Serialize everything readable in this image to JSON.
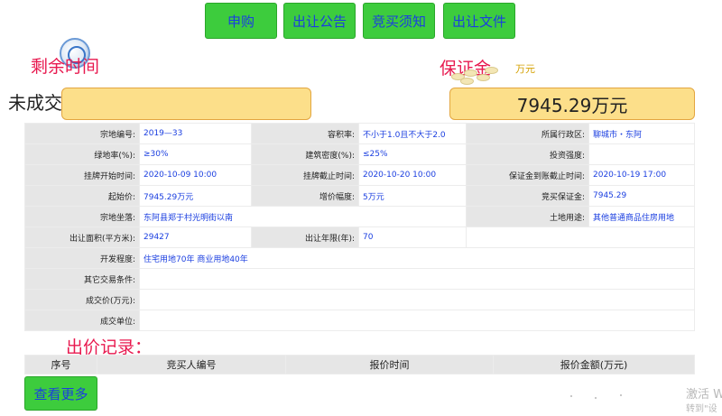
{
  "top_buttons": {
    "apply": "申购",
    "announcement": "出让公告",
    "notice": "竞买须知",
    "documents": "出让文件"
  },
  "countdown": {
    "title": "剩余时间",
    "status": "未成交"
  },
  "deposit": {
    "title": "保证金",
    "unit": "万元",
    "value": "7945.29万元"
  },
  "info": {
    "parcel_no": {
      "label": "宗地编号:",
      "value": "2019—33"
    },
    "plot_ratio": {
      "label": "容积率:",
      "value": "不小于1.0且不大于2.0"
    },
    "district": {
      "label": "所属行政区:",
      "value": "聊城市・东阿"
    },
    "green_rate": {
      "label": "绿地率(%):",
      "value": "≥30%"
    },
    "building_density": {
      "label": "建筑密度(%):",
      "value": "≤25%"
    },
    "investment_intensity": {
      "label": "投资强度:",
      "value": ""
    },
    "listing_start": {
      "label": "挂牌开始时间:",
      "value": "2020-10-09 10:00"
    },
    "listing_end": {
      "label": "挂牌截止时间:",
      "value": "2020-10-20 10:00"
    },
    "deposit_deadline": {
      "label": "保证金到账截止时间:",
      "value": "2020-10-19 17:00"
    },
    "starting_price": {
      "label": "起始价:",
      "value": "7945.29万元"
    },
    "increment": {
      "label": "增价幅度:",
      "value": "5万元"
    },
    "bid_deposit": {
      "label": "竞买保证金:",
      "value": "7945.29"
    },
    "location": {
      "label": "宗地坐落:",
      "value": "东阿县郑于村光明街以南"
    },
    "land_use": {
      "label": "土地用途:",
      "value": "其他普通商品住房用地"
    },
    "area": {
      "label": "出让面积(平方米):",
      "value": "29427"
    },
    "term": {
      "label": "出让年限(年):",
      "value": "70"
    },
    "development": {
      "label": "开发程度:",
      "value": "住宅用地70年 商业用地40年"
    },
    "other_conditions": {
      "label": "其它交易条件:",
      "value": ""
    },
    "deal_price": {
      "label": "成交价(万元):",
      "value": ""
    },
    "deal_unit": {
      "label": "成交单位:",
      "value": ""
    }
  },
  "bids": {
    "title": "出价记录：",
    "columns": [
      "序号",
      "竞买人编号",
      "报价时间",
      "报价金额(万元)"
    ]
  },
  "more_button": "查看更多",
  "watermark": {
    "line1": "激活 W",
    "line2": "转到\"设"
  }
}
